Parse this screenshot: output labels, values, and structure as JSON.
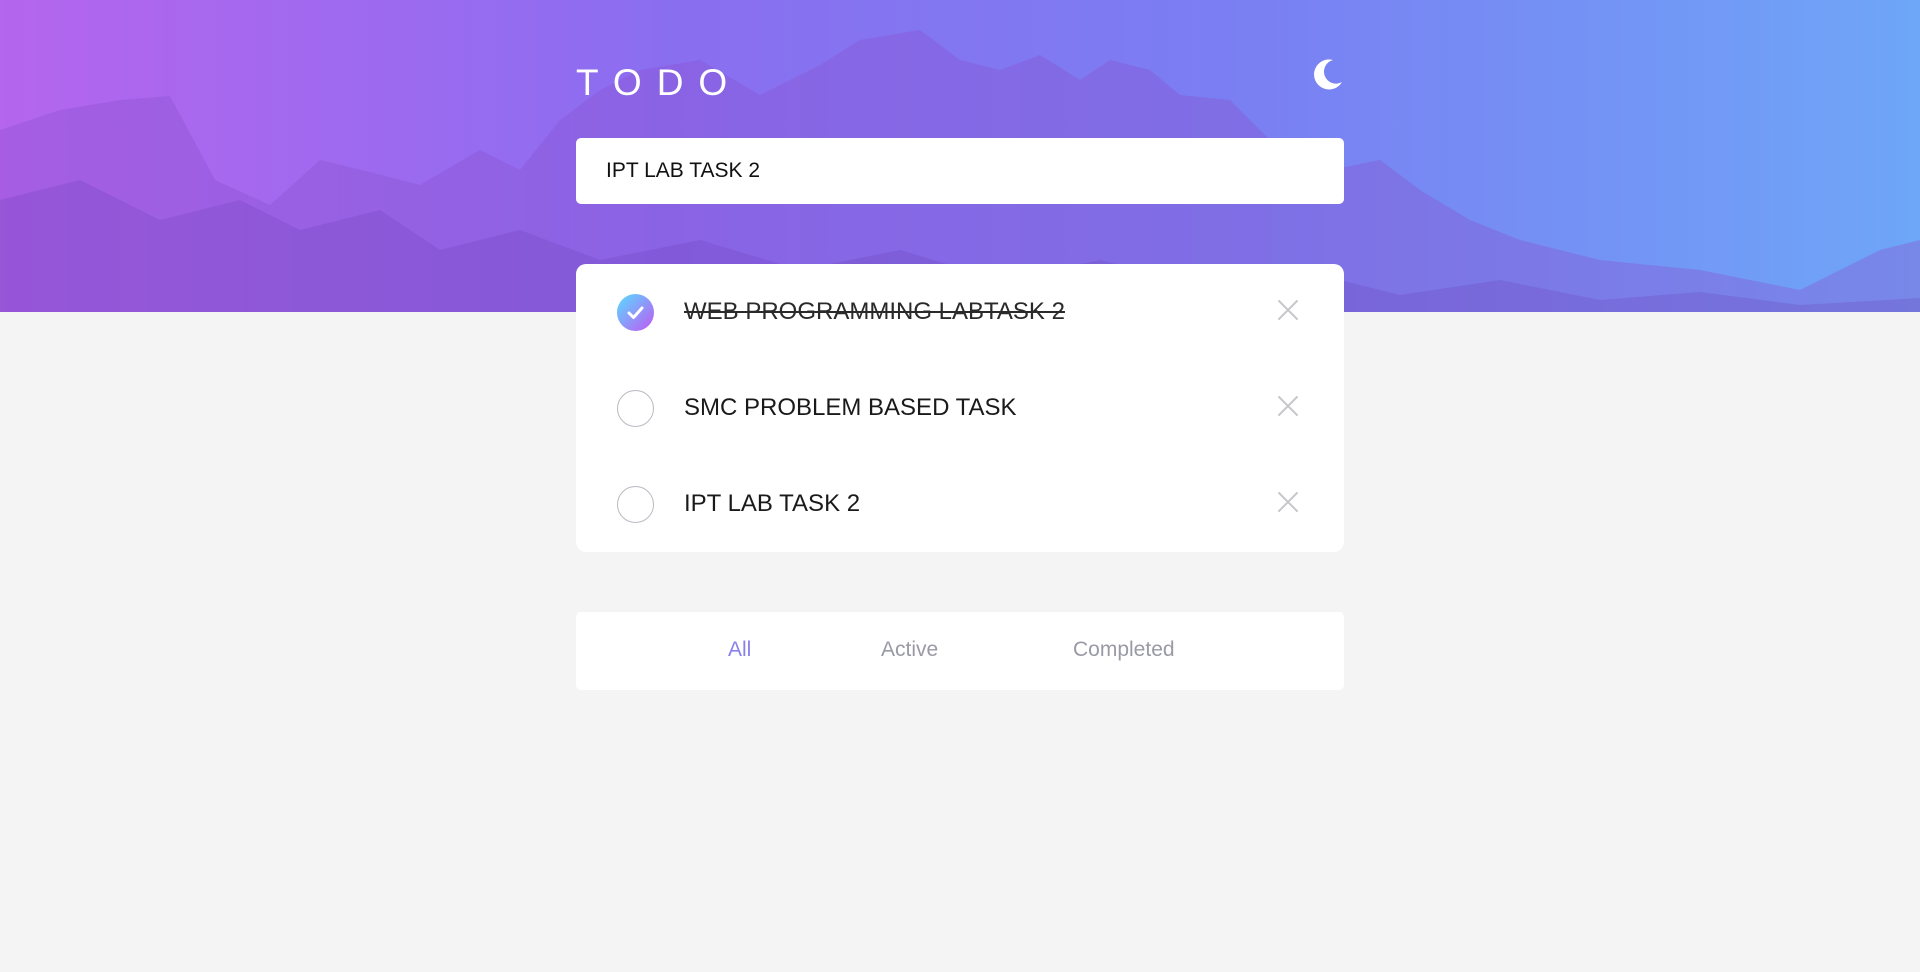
{
  "app": {
    "title": "TODO",
    "theme_toggle_icon": "moon-icon"
  },
  "new_todo": {
    "value": "IPT LAB TASK 2",
    "placeholder": ""
  },
  "todos": [
    {
      "text": "WEB PROGRAMMING LABTASK 2",
      "completed": true,
      "check_icon": "checkmark-icon",
      "delete_icon": "close-icon"
    },
    {
      "text": "SMC PROBLEM BASED TASK",
      "completed": false,
      "check_icon": "",
      "delete_icon": "close-icon"
    },
    {
      "text": "IPT LAB TASK 2",
      "completed": false,
      "check_icon": "",
      "delete_icon": "close-icon"
    }
  ],
  "filters": {
    "all": "All",
    "active": "Active",
    "completed": "Completed",
    "selected": "all"
  },
  "colors": {
    "accent": "#8a80ea",
    "check_gradient_start": "#57ddff",
    "check_gradient_end": "#c058f3",
    "page_background": "#f4f4f4"
  }
}
